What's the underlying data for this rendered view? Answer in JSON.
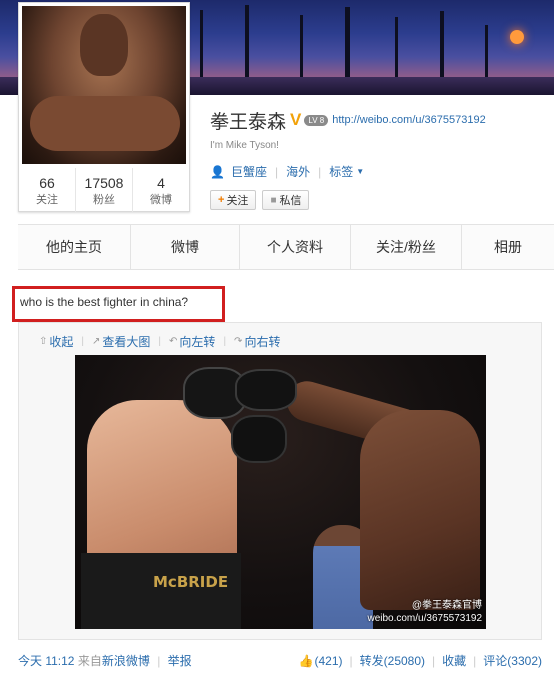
{
  "profile": {
    "name": "拳王泰森",
    "verified_icon": "V",
    "level_badge": "LV 8",
    "url": "http://weibo.com/u/3675573192",
    "bio": "I'm Mike Tyson!",
    "tags": [
      {
        "label": "巨蟹座"
      },
      {
        "label": "海外"
      },
      {
        "label": "标签"
      }
    ],
    "follow_button": "关注",
    "message_button": "私信",
    "stats": [
      {
        "num": "66",
        "label": "关注"
      },
      {
        "num": "17508",
        "label": "粉丝"
      },
      {
        "num": "4",
        "label": "微博"
      }
    ]
  },
  "tabs": [
    {
      "label": "他的主页"
    },
    {
      "label": "微博"
    },
    {
      "label": "个人资料"
    },
    {
      "label": "关注/粉丝"
    },
    {
      "label": "相册"
    }
  ],
  "post": {
    "text": "who is the best fighter in china?",
    "tools": {
      "collapse": "收起",
      "view_large": "查看大图",
      "rotate_left": "向左转",
      "rotate_right": "向右转"
    },
    "photo": {
      "trunks_text": "McBRIDE",
      "watermark_handle": "@拳王泰森官博",
      "watermark_url": "weibo.com/u/3675573192"
    }
  },
  "footer": {
    "time": "今天 11:12",
    "from": "来自",
    "source": "新浪微博",
    "report": "举报",
    "likes": "(421)",
    "repost": "转发(25080)",
    "favorite": "收藏",
    "comment": "评论(3302)"
  },
  "colors": {
    "link": "#2b6dad",
    "highlight_border": "#d11f1f",
    "verified": "#f2a20a"
  }
}
